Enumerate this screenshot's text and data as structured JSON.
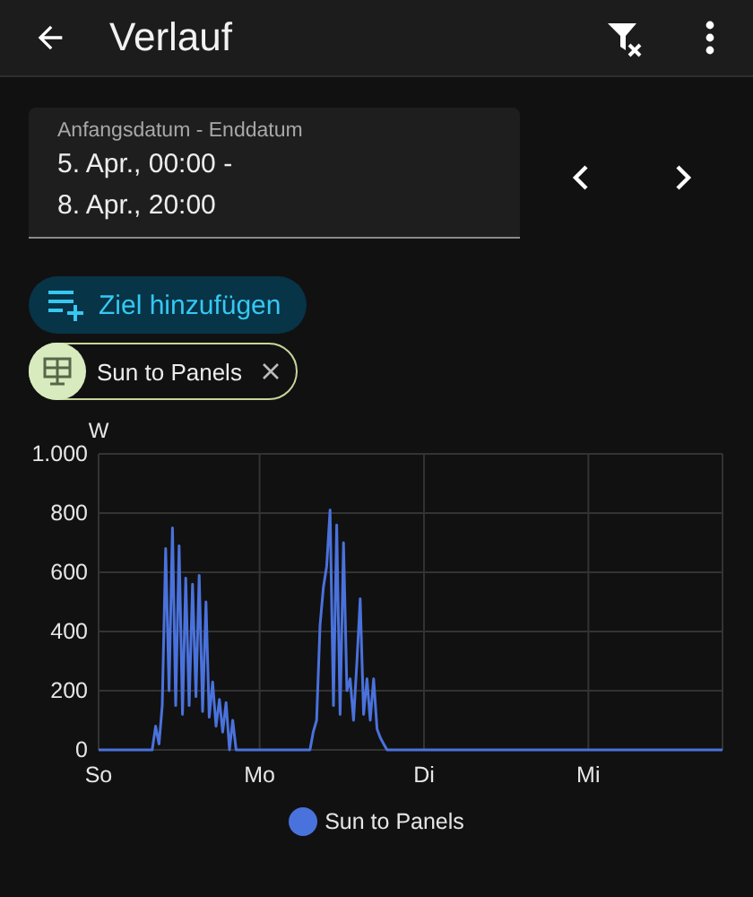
{
  "header": {
    "title": "Verlauf"
  },
  "date_range": {
    "label": "Anfangsdatum - Enddatum",
    "value_lines": [
      "5. Apr., 00:00 -",
      "8. Apr., 20:00"
    ]
  },
  "add_target_button": {
    "label": "Ziel hinzufügen"
  },
  "targets": [
    {
      "label": "Sun to Panels"
    }
  ],
  "chart": {
    "chart_data": {
      "type": "line",
      "grid": true,
      "ylabel": "W",
      "ylim": [
        0,
        1000
      ],
      "yticks": [
        0,
        200,
        400,
        600,
        800,
        {
          "value": 1000,
          "label": "1.000"
        }
      ],
      "categories": [
        "So",
        null,
        null,
        null,
        null,
        null,
        null,
        null,
        null,
        null,
        null,
        null,
        null,
        null,
        null,
        null,
        null,
        null,
        null,
        null,
        null,
        null,
        null,
        null,
        null,
        null,
        null,
        null,
        null,
        null,
        null,
        null,
        null,
        null,
        null,
        null,
        null,
        null,
        null,
        null,
        null,
        null,
        null,
        null,
        null,
        null,
        null,
        null,
        "Mo",
        null,
        null,
        null,
        null,
        null,
        null,
        null,
        null,
        null,
        null,
        null,
        null,
        null,
        null,
        null,
        null,
        null,
        null,
        null,
        null,
        null,
        null,
        null,
        null,
        null,
        null,
        null,
        null,
        null,
        null,
        null,
        null,
        null,
        null,
        null,
        null,
        null,
        null,
        null,
        null,
        null,
        null,
        null,
        null,
        null,
        null,
        null,
        null,
        "Di",
        null,
        null,
        null,
        null,
        null,
        null,
        null,
        null,
        null,
        null,
        null,
        null,
        null,
        null,
        null,
        null,
        null,
        null,
        null,
        null,
        null,
        null,
        null,
        null,
        null,
        null,
        null,
        null,
        null,
        null,
        null,
        null,
        null,
        null,
        null,
        null,
        null,
        null,
        null,
        null,
        null,
        null,
        null,
        null,
        null,
        null,
        null,
        null,
        "Mi",
        null,
        null,
        null,
        null,
        null,
        null,
        null,
        null,
        null,
        null,
        null,
        null,
        null,
        null,
        null,
        null,
        null,
        null,
        null,
        null,
        null,
        null,
        null,
        null,
        null,
        null,
        null,
        null,
        null,
        null,
        null,
        null,
        null,
        null,
        null,
        null,
        null,
        null,
        null,
        null
      ],
      "series": [
        {
          "name": "Sun to Panels",
          "color": "#4a72dc",
          "values": [
            0,
            0,
            0,
            0,
            0,
            0,
            0,
            0,
            0,
            0,
            0,
            0,
            0,
            0,
            0,
            0,
            0,
            80,
            20,
            150,
            680,
            200,
            750,
            150,
            690,
            120,
            580,
            150,
            560,
            180,
            590,
            130,
            500,
            110,
            230,
            80,
            170,
            60,
            160,
            0,
            100,
            0,
            0,
            0,
            0,
            0,
            0,
            0,
            0,
            0,
            0,
            0,
            0,
            0,
            0,
            0,
            0,
            0,
            0,
            0,
            0,
            0,
            0,
            0,
            60,
            100,
            420,
            550,
            620,
            810,
            150,
            760,
            120,
            700,
            200,
            240,
            100,
            300,
            510,
            120,
            240,
            100,
            240,
            70,
            40,
            20,
            0,
            0,
            0,
            0,
            0,
            0,
            0,
            0,
            0,
            0,
            0,
            0,
            0,
            0,
            0,
            0,
            0,
            0,
            0,
            0,
            0,
            0,
            0,
            0,
            0,
            0,
            0,
            0,
            0,
            0,
            0,
            0,
            0,
            0,
            0,
            0,
            0,
            0,
            0,
            0,
            0,
            0,
            0,
            0,
            0,
            0,
            0,
            0,
            0,
            0,
            0,
            0,
            0,
            0,
            0,
            0,
            0,
            0,
            0,
            0,
            0,
            0,
            0,
            0,
            0,
            0,
            0,
            0,
            0,
            0,
            0,
            0,
            0,
            0,
            0,
            0,
            0,
            0,
            0,
            0,
            0,
            0,
            0,
            0,
            0,
            0,
            0,
            0,
            0,
            0,
            0,
            0,
            0,
            0,
            0,
            0,
            0,
            0,
            0,
            0,
            0
          ]
        }
      ]
    }
  }
}
